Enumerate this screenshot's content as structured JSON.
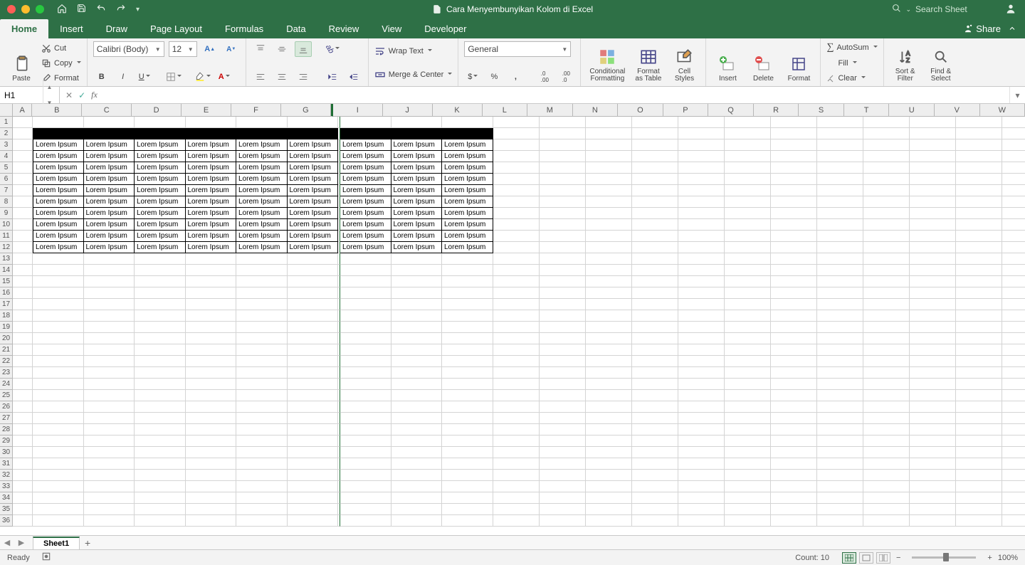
{
  "title": "Cara Menyembunyikan Kolom di Excel",
  "search_placeholder": "Search Sheet",
  "tabs": [
    "Home",
    "Insert",
    "Draw",
    "Page Layout",
    "Formulas",
    "Data",
    "Review",
    "View",
    "Developer"
  ],
  "active_tab_index": 0,
  "share": "Share",
  "ribbon": {
    "paste": "Paste",
    "cut": "Cut",
    "copy": "Copy",
    "format_painter": "Format",
    "font_name": "Calibri (Body)",
    "font_size": "12",
    "wrap": "Wrap Text",
    "merge": "Merge & Center",
    "number_format": "General",
    "cond_fmt": "Conditional\nFormatting",
    "as_table": "Format\nas Table",
    "styles": "Cell\nStyles",
    "insert": "Insert",
    "delete": "Delete",
    "format": "Format",
    "autosum": "AutoSum",
    "fill": "Fill",
    "clear": "Clear",
    "sort": "Sort &\nFilter",
    "find": "Find &\nSelect"
  },
  "name_box": "H1",
  "columns": [
    "A",
    "B",
    "C",
    "D",
    "E",
    "F",
    "G",
    "I",
    "J",
    "K",
    "L",
    "M",
    "N",
    "O",
    "P",
    "Q",
    "R",
    "S",
    "T",
    "U",
    "V",
    "W"
  ],
  "hidden_after_index": 6,
  "first_col_width": 28,
  "data_col_width": 71.5,
  "empty_col_width": 65,
  "total_rows": 36,
  "black_row": 2,
  "data_rows_start": 3,
  "data_rows_end": 12,
  "data_cols_count": 9,
  "cell_text": "Lorem Ipsum",
  "sheet_name": "Sheet1",
  "status_ready": "Ready",
  "status_count": "Count: 10",
  "zoom": "100%"
}
